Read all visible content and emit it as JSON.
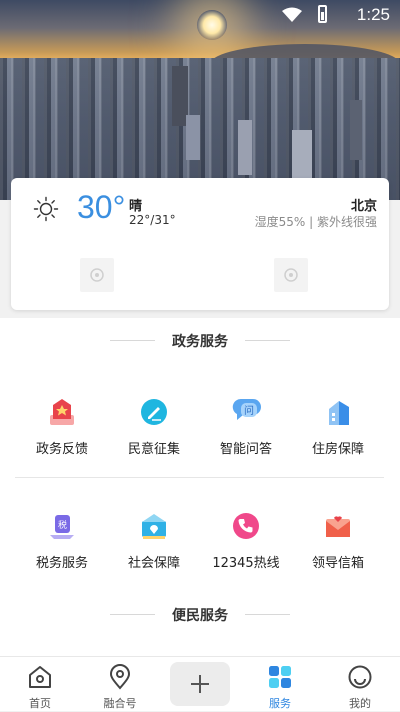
{
  "status_bar": {
    "time": "1:25"
  },
  "weather": {
    "temperature": "30°",
    "condition": "晴",
    "range": "22°/31°",
    "city": "北京",
    "detail": "湿度55% | 紫外线很强"
  },
  "sections": {
    "gov_title": "政务服务",
    "convenience_title": "便民服务"
  },
  "services": [
    {
      "label": "政务反馈",
      "icon": "government-feedback-icon",
      "color": "#e8434b"
    },
    {
      "label": "民意征集",
      "icon": "opinion-collection-icon",
      "color": "#1fb6e0"
    },
    {
      "label": "智能问答",
      "icon": "smart-qa-icon",
      "color": "#3a8ee8"
    },
    {
      "label": "住房保障",
      "icon": "housing-security-icon",
      "color": "#3a8ee8"
    },
    {
      "label": "税务服务",
      "icon": "tax-service-icon",
      "color": "#7a6ae6"
    },
    {
      "label": "社会保障",
      "icon": "social-security-icon",
      "color": "#2fb1e6"
    },
    {
      "label": "12345热线",
      "icon": "hotline-phone-icon",
      "color": "#f0488a"
    },
    {
      "label": "领导信箱",
      "icon": "leader-mailbox-icon",
      "color": "#f0604a"
    }
  ],
  "nav": {
    "home": "首页",
    "media": "融合号",
    "services": "服务",
    "mine": "我的",
    "active_color": "#2e86e0"
  }
}
